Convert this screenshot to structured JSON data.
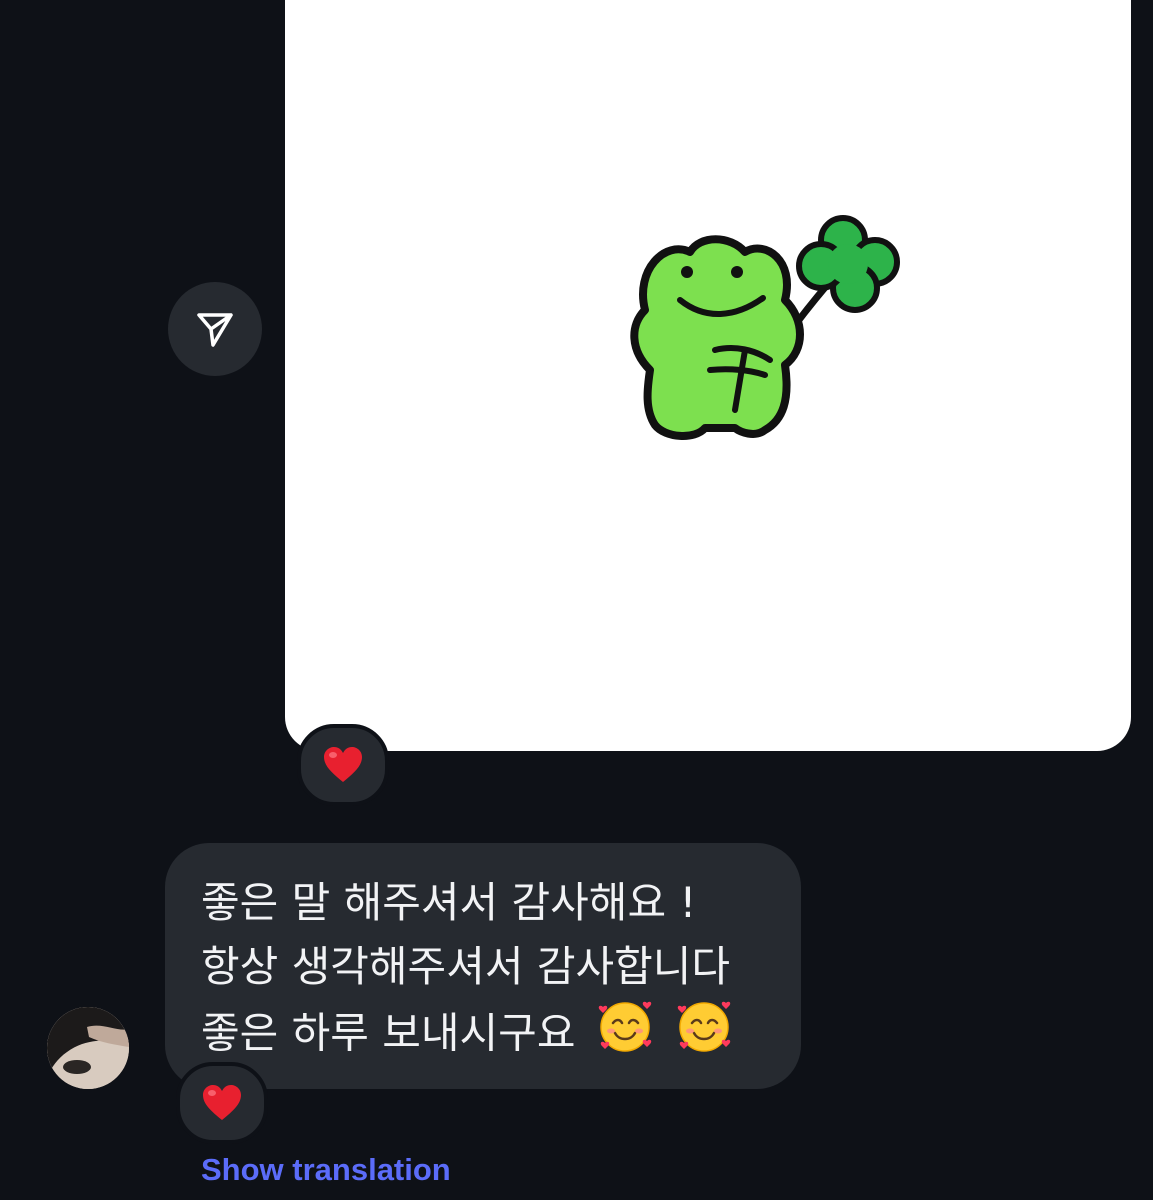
{
  "conversation": {
    "shared_image": {
      "content": "frog-with-clover-sticker",
      "reaction": "❤️"
    },
    "share_button": {
      "icon": "paper-plane-icon"
    },
    "incoming_message": {
      "lines": [
        "좋은 말 해주셔서 감사해요 !",
        "항상 생각해주셔서 감사합니다",
        "좋은 하루 보내시구요"
      ],
      "emojis": [
        "🥰",
        "🥰"
      ],
      "reaction": "❤️",
      "show_translation_label": "Show translation"
    }
  },
  "colors": {
    "background": "#0e1117",
    "bubble": "#262a30",
    "text": "#f2f3f5",
    "link": "#5b6cf9",
    "heart": "#e8202f"
  }
}
